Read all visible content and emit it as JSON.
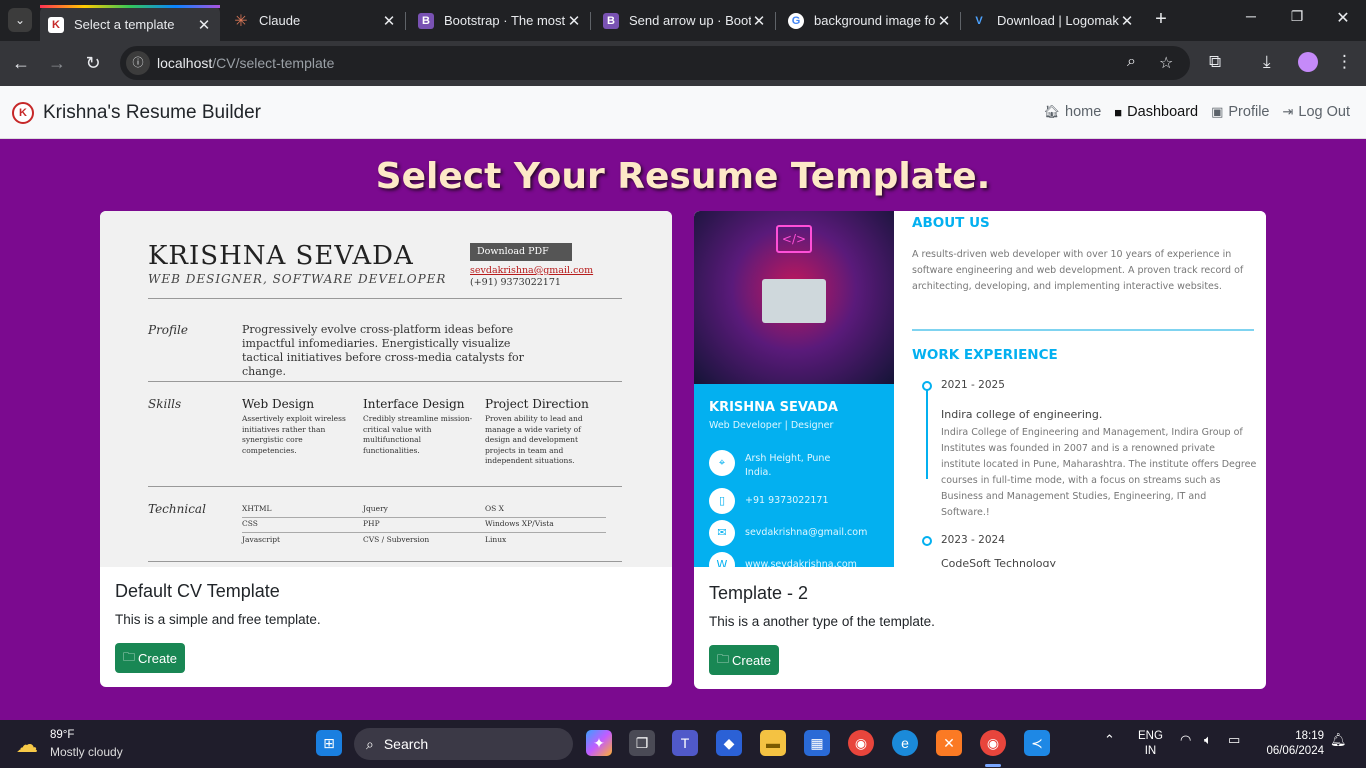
{
  "browser": {
    "tabs": [
      {
        "title": "Select a template",
        "favicon": "K",
        "favicon_bg": "#ffffff",
        "favicon_color": "#c62828",
        "active": true
      },
      {
        "title": "Claude",
        "favicon": "✳",
        "favicon_bg": "transparent",
        "favicon_color": "#d97757",
        "active": false
      },
      {
        "title": "Bootstrap · The most",
        "favicon": "B",
        "favicon_bg": "#7952b3",
        "favicon_color": "#ffffff",
        "active": false
      },
      {
        "title": "Send arrow up · Boot",
        "favicon": "B",
        "favicon_bg": "#7952b3",
        "favicon_color": "#ffffff",
        "active": false
      },
      {
        "title": "background image fo",
        "favicon": "G",
        "favicon_bg": "#ffffff",
        "favicon_color": "#4285f4",
        "active": false
      },
      {
        "title": "Download | Logomak",
        "favicon": "V",
        "favicon_bg": "transparent",
        "favicon_color": "#4da3ff",
        "active": false
      }
    ],
    "url_host": "localhost",
    "url_path": "/CV/select-template"
  },
  "navbar": {
    "brand_logo": "K",
    "brand": "Krishna's Resume Builder",
    "links": [
      {
        "label": "home",
        "icon": "house-icon"
      },
      {
        "label": "Dashboard",
        "icon": "box-icon"
      },
      {
        "label": "Profile",
        "icon": "person-badge-icon"
      },
      {
        "label": "Log Out",
        "icon": "box-arrow-right-icon"
      }
    ]
  },
  "heading": "Select Your Resume Template.",
  "cards": [
    {
      "title": "Default CV Template",
      "text": "This is a simple and free template.",
      "button": "Create",
      "preview": {
        "name": "KRISHNA SEVADA",
        "role": "WEB DESIGNER, SOFTWARE DEVELOPER",
        "download": "Download PDF",
        "email": "sevdakrishna@gmail.com",
        "phone": "(+91) 9373022171",
        "profile_label": "Profile",
        "profile_text": "Progressively evolve cross-platform ideas before impactful infomediaries. Energistically visualize tactical initiatives before cross-media catalysts for change.",
        "skills_label": "Skills",
        "skills": [
          {
            "title": "Web Design",
            "desc": "Assertively exploit wireless initiatives rather than synergistic core competencies."
          },
          {
            "title": "Interface Design",
            "desc": "Credibly streamline mission-critical value with multifunctional functionalities."
          },
          {
            "title": "Project Direction",
            "desc": "Proven ability to lead and manage a wide variety of design and development projects in team and independent situations."
          }
        ],
        "technical_label": "Technical",
        "technical": [
          [
            "XHTML",
            "Jquery",
            "OS X"
          ],
          [
            "CSS",
            "PHP",
            "Windows XP/Vista"
          ],
          [
            "Javascript",
            "CVS / Subversion",
            "Linux"
          ]
        ]
      }
    },
    {
      "title": "Template - 2",
      "text": "This is a another type of the template.",
      "button": "Create",
      "preview": {
        "name": "KRISHNA SEVADA",
        "role": "Web Developer | Designer",
        "address": "Arsh Height, Pune India.",
        "phone": "+91 9373022171",
        "email": "sevdakrishna@gmail.com",
        "website": "www.sevdakrishna.com",
        "about_heading": "ABOUT US",
        "about_text": "A results-driven web developer with over 10 years of experience in software engineering and web development. A proven track record of architecting, developing, and implementing interactive websites.",
        "work_heading": "WORK EXPERIENCE",
        "jobs": [
          {
            "years": "2021 - 2025",
            "org": "Indira college of engineering.",
            "desc": "Indira College of Engineering and Management, Indira Group of Institutes was founded in 2007 and is a renowned private institute located in Pune, Maharashtra. The institute offers Degree courses in full-time mode, with a focus on streams such as Business and Management Studies, Engineering, IT and Software.!"
          },
          {
            "years": "2023 - 2024",
            "org": "CodeSoft Technology"
          }
        ]
      }
    }
  ],
  "taskbar": {
    "temp": "89°F",
    "condition": "Mostly cloudy",
    "search": "Search",
    "lang_top": "ENG",
    "lang_bottom": "IN",
    "time": "18:19",
    "date": "06/06/2024"
  },
  "colors": {
    "page_bg": "#7b0a8f",
    "heading": "#fde9c7",
    "create_button": "#198754",
    "template2_accent": "#03b0f0"
  }
}
